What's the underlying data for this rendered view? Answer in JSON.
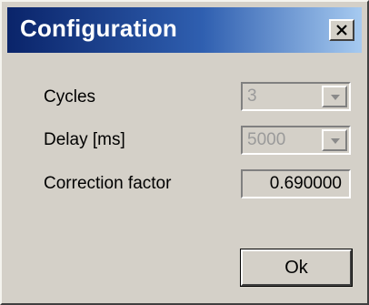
{
  "window": {
    "title": "Configuration",
    "close_icon": "close-x-icon"
  },
  "fields": {
    "cycles": {
      "label": "Cycles",
      "value": "3",
      "enabled": false
    },
    "delay": {
      "label": "Delay [ms]",
      "value": "5000",
      "enabled": false
    },
    "correction": {
      "label": "Correction factor",
      "value": "0.690000"
    }
  },
  "buttons": {
    "ok_label": "Ok"
  },
  "colors": {
    "titlebar_start": "#0a246a",
    "titlebar_end": "#a6caf0",
    "dialog_face": "#d4d0c8",
    "disabled_text": "#9a9a9a"
  }
}
